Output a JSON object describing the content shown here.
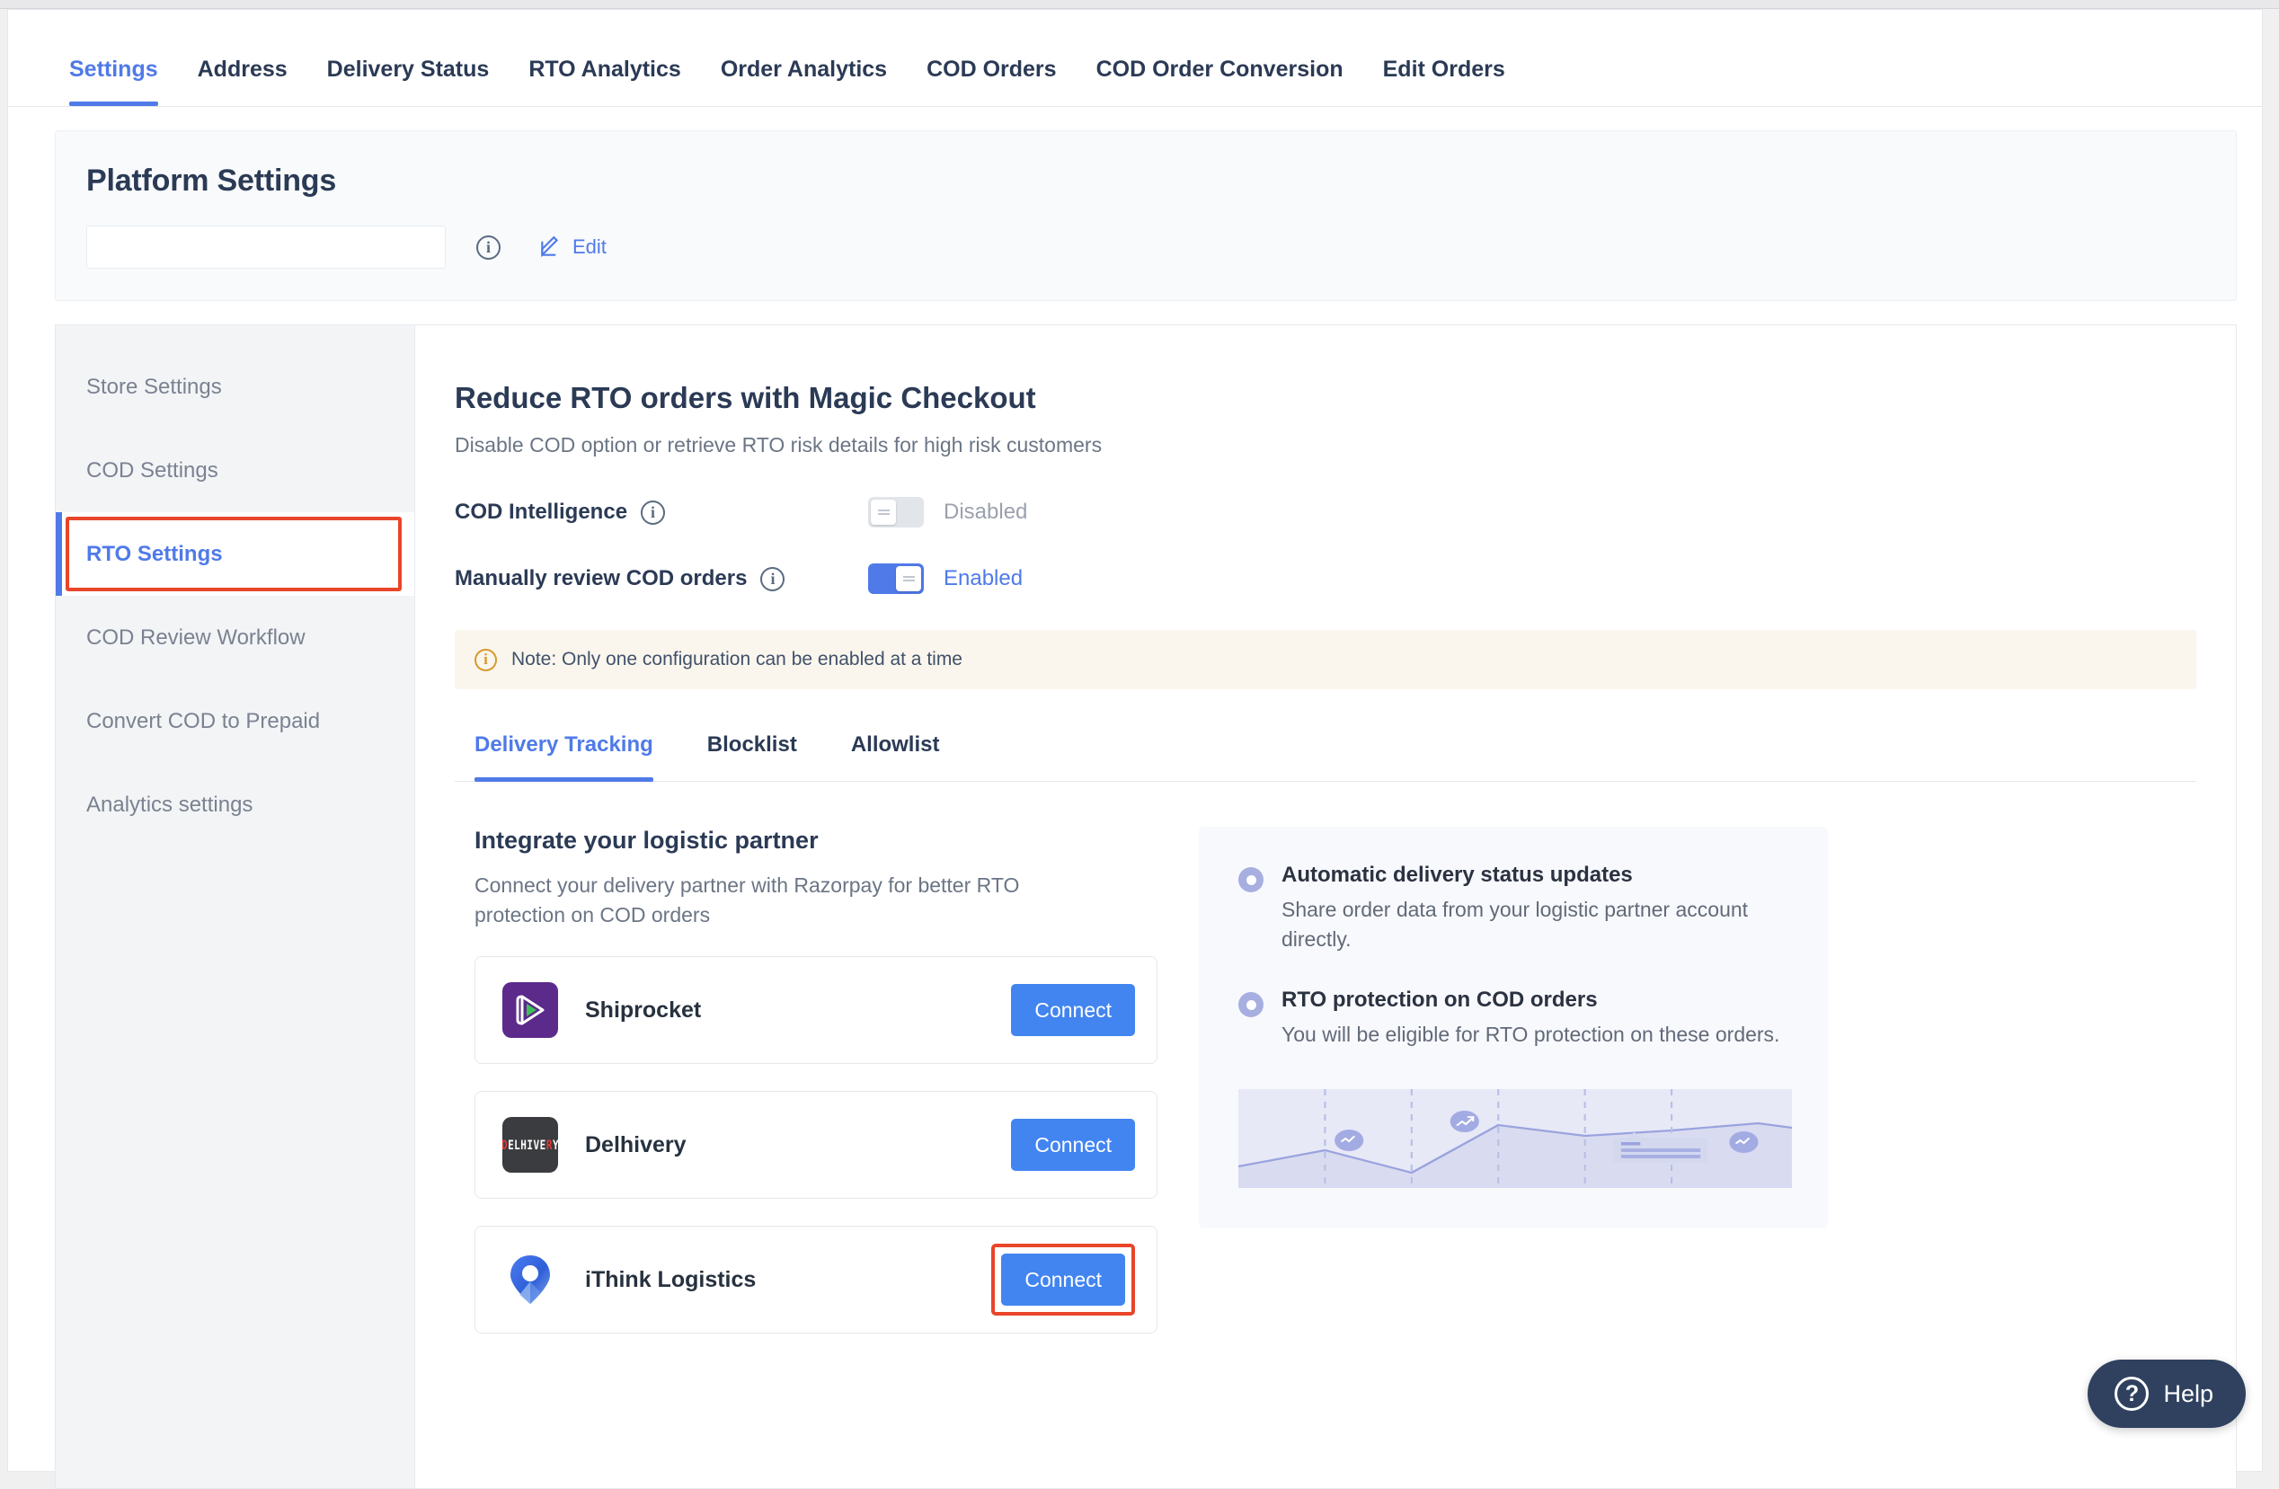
{
  "topnav": {
    "items": [
      {
        "label": "Settings",
        "active": true
      },
      {
        "label": "Address",
        "active": false
      },
      {
        "label": "Delivery Status",
        "active": false
      },
      {
        "label": "RTO Analytics",
        "active": false
      },
      {
        "label": "Order Analytics",
        "active": false
      },
      {
        "label": "COD Orders",
        "active": false
      },
      {
        "label": "COD Order Conversion",
        "active": false
      },
      {
        "label": "Edit Orders",
        "active": false
      }
    ]
  },
  "platform_settings": {
    "title": "Platform Settings",
    "input_value": "",
    "input_placeholder": "",
    "info_icon": "info-icon",
    "edit_label": "Edit",
    "edit_icon": "edit-pencil-icon"
  },
  "sidebar": {
    "items": [
      {
        "label": "Store Settings",
        "active": false
      },
      {
        "label": "COD Settings",
        "active": false
      },
      {
        "label": "RTO Settings",
        "active": true
      },
      {
        "label": "COD Review Workflow",
        "active": false
      },
      {
        "label": "Convert COD to Prepaid",
        "active": false
      },
      {
        "label": "Analytics settings",
        "active": false
      }
    ]
  },
  "content": {
    "title": "Reduce RTO orders with Magic Checkout",
    "subtitle": "Disable COD option or retrieve RTO risk details for high risk customers",
    "toggles": [
      {
        "label": "COD Intelligence",
        "state": "Disabled",
        "on": false,
        "info_icon": "info-icon"
      },
      {
        "label": "Manually review COD orders",
        "state": "Enabled",
        "on": true,
        "info_icon": "info-icon"
      }
    ],
    "note": {
      "icon": "warning-info-icon",
      "text": "Note: Only one configuration can be enabled at a time"
    },
    "tabs": [
      {
        "label": "Delivery Tracking",
        "active": true
      },
      {
        "label": "Blocklist",
        "active": false
      },
      {
        "label": "Allowlist",
        "active": false
      }
    ],
    "integrate": {
      "title": "Integrate your logistic partner",
      "subtitle": "Connect your delivery partner with Razorpay for better RTO protection on COD orders",
      "partners": [
        {
          "name": "Shiprocket",
          "logo": "shiprocket-logo",
          "button": "Connect",
          "highlighted": false
        },
        {
          "name": "Delhivery",
          "logo": "delhivery-logo",
          "button": "Connect",
          "highlighted": false
        },
        {
          "name": "iThink Logistics",
          "logo": "ithink-logistics-logo",
          "button": "Connect",
          "highlighted": true
        }
      ]
    },
    "info_panel": {
      "bullets": [
        {
          "title": "Automatic delivery status updates",
          "desc": "Share order data from your logistic partner account directly."
        },
        {
          "title": "RTO protection on COD orders",
          "desc": "You will be eligible for RTO protection on these orders."
        }
      ],
      "illustration": "delivery-trend-chart-illustration"
    }
  },
  "help": {
    "label": "Help",
    "icon": "question-mark-circle-icon"
  },
  "colors": {
    "accent_blue": "#4f7ae8",
    "button_blue": "#4285f0",
    "highlight_red": "#e8452a",
    "heading_navy": "#2b3a55",
    "note_bg": "#faf6ed",
    "note_icon": "#d89a2e",
    "help_bg": "#2f415f",
    "bullet_dot": "#a7aee0",
    "shiprocket_purple": "#5b2a8a",
    "delhivery_dark": "#3a3c3f"
  }
}
